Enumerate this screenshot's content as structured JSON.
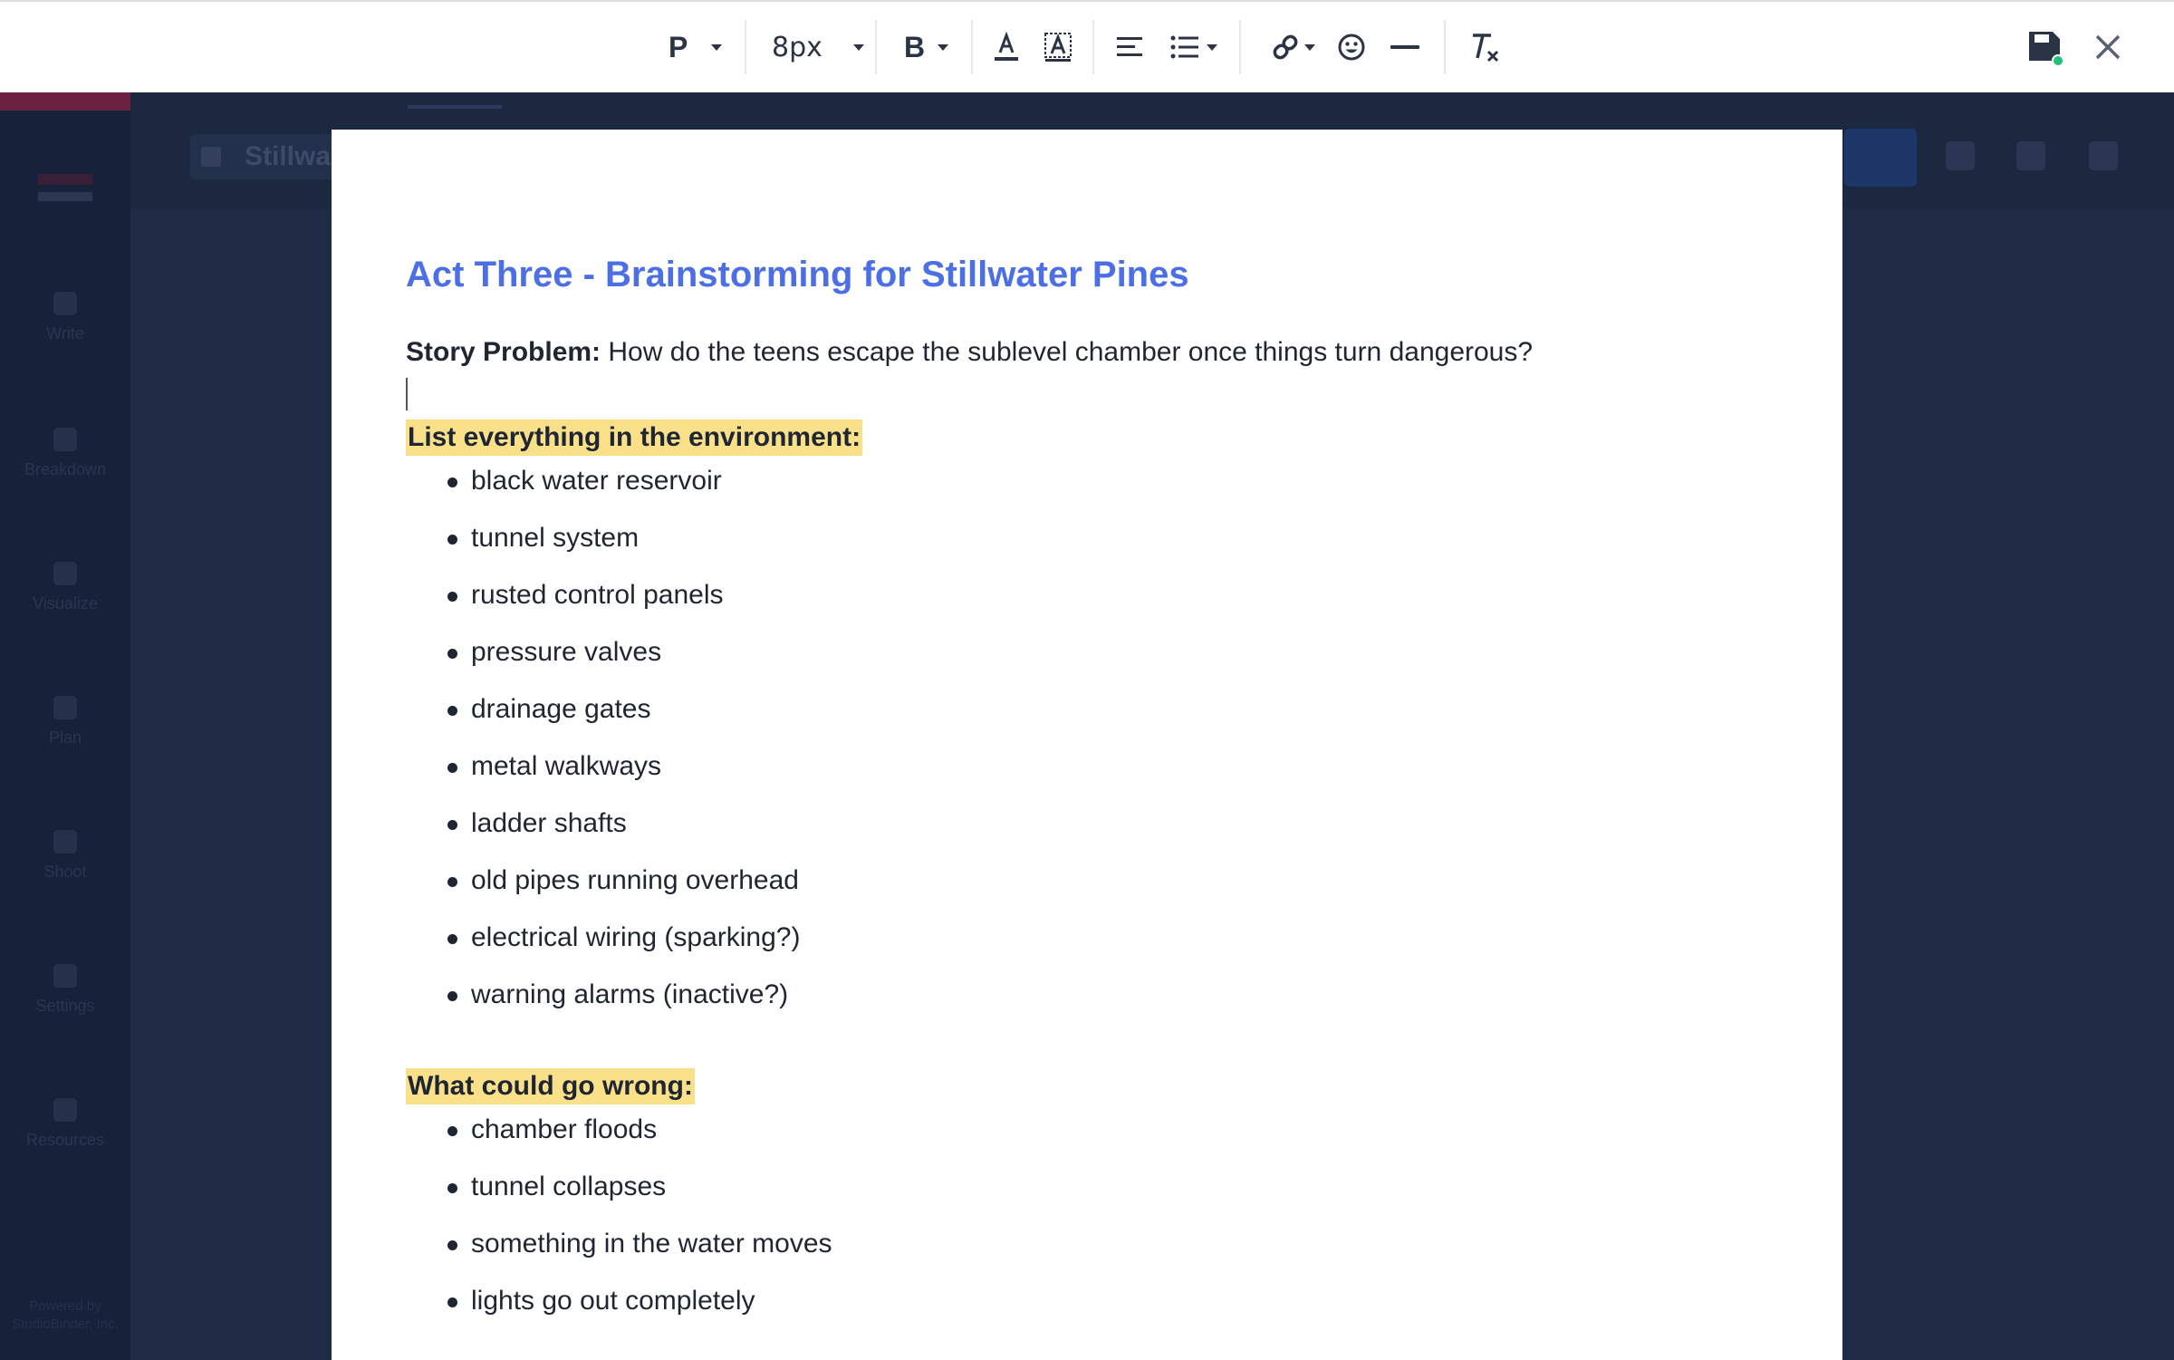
{
  "toolbar": {
    "paragraph_format": "P",
    "font_size": "8px",
    "bold_label": "B"
  },
  "background_app": {
    "title_fragment": "Stillwa",
    "nav": [
      "Write",
      "Breakdown",
      "Visualize",
      "Plan",
      "Shoot",
      "Settings",
      "Resources"
    ],
    "powered_by": "Powered by StudioBinder, Inc."
  },
  "document": {
    "title": "Act Three - Brainstorming for Stillwater Pines",
    "story_problem_label": "Story Problem:",
    "story_problem_text": " How do the teens escape the sublevel chamber once things turn dangerous?",
    "section1_heading": "List everything in the environment:",
    "section1_items": [
      "black water reservoir",
      "tunnel system",
      "rusted control panels",
      "pressure valves",
      "drainage gates",
      "metal walkways",
      "ladder shafts",
      "old pipes running overhead",
      "electrical wiring (sparking?)",
      "warning alarms (inactive?)"
    ],
    "section2_heading": "What could go wrong:",
    "section2_items": [
      "chamber floods",
      "tunnel collapses",
      "something in the water moves",
      "lights go out completely"
    ]
  },
  "colors": {
    "title": "#4d6fe6",
    "highlight": "#fbe08a",
    "save_status": "#1ec27a"
  }
}
